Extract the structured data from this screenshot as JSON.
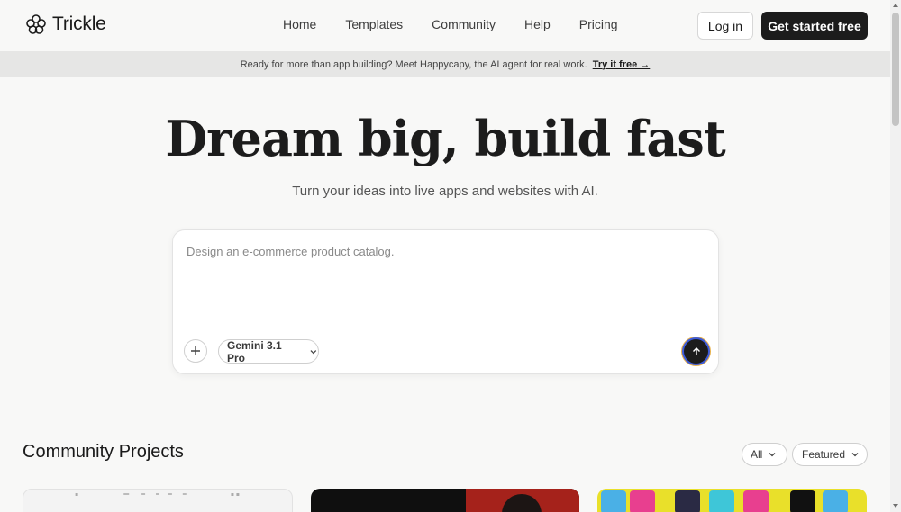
{
  "header": {
    "brand": "Trickle",
    "nav": [
      "Home",
      "Templates",
      "Community",
      "Help",
      "Pricing"
    ],
    "login_label": "Log in",
    "cta_label": "Get started free"
  },
  "banner": {
    "text": "Ready for more than app building? Meet Happycapy, the AI agent for real work.",
    "link_label": "Try it free →"
  },
  "hero": {
    "title": "Dream big, build fast",
    "subtitle": "Turn your ideas into live apps and websites with AI."
  },
  "prompt": {
    "placeholder": "Design an e-commerce product catalog.",
    "value": "",
    "model": "Gemini 3.1 Pro",
    "add_icon": "plus-icon",
    "send_icon": "arrow-up-icon"
  },
  "community": {
    "title": "Community Projects",
    "filter_all": "All",
    "filter_sort": "Featured"
  },
  "colors": {
    "background": "#f8f8f7",
    "primary": "#1c1c1c",
    "banner": "#e6e6e5"
  }
}
